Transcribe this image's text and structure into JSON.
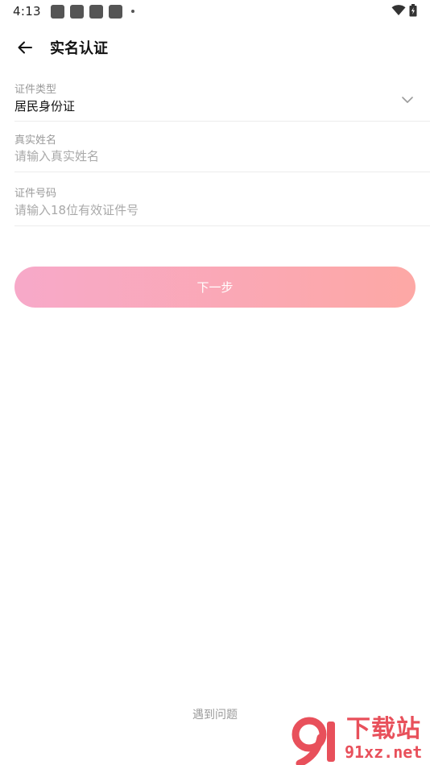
{
  "status_bar": {
    "time": "4:13"
  },
  "header": {
    "title": "实名认证"
  },
  "form": {
    "id_type": {
      "label": "证件类型",
      "value": "居民身份证"
    },
    "real_name": {
      "label": "真实姓名",
      "placeholder": "请输入真实姓名"
    },
    "id_number": {
      "label": "证件号码",
      "placeholder": "请输入18位有效证件号"
    }
  },
  "actions": {
    "next_label": "下一步"
  },
  "footer": {
    "help_label": "遇到问题"
  },
  "watermark": {
    "top_text": "下载站",
    "bottom_text": "91xz.net"
  },
  "colors": {
    "button_gradient_start": "#f7a9c9",
    "button_gradient_end": "#fda8a5",
    "watermark": "#e8505b"
  }
}
